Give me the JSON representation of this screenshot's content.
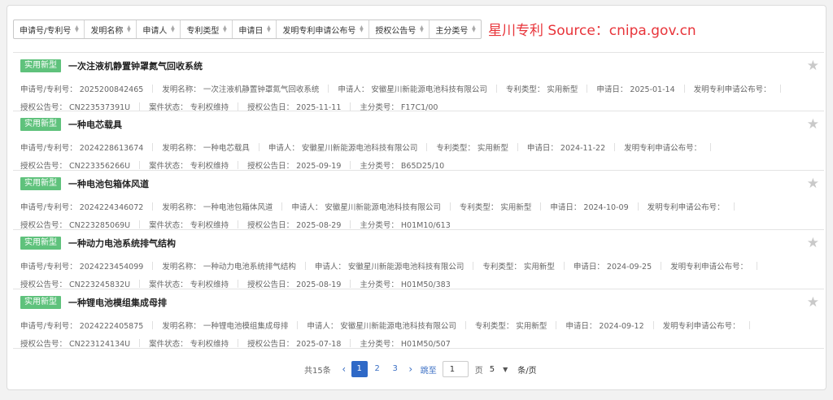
{
  "sort_fields": [
    {
      "label": "申请号/专利号"
    },
    {
      "label": "发明名称"
    },
    {
      "label": "申请人"
    },
    {
      "label": "专利类型"
    },
    {
      "label": "申请日"
    },
    {
      "label": "发明专利申请公布号"
    },
    {
      "label": "授权公告号"
    },
    {
      "label": "主分类号"
    }
  ],
  "watermark": "星川专利  Source：cnipa.gov.cn",
  "items": [
    {
      "tag": "实用新型",
      "title": "一次注液机静置钟罩氮气回收系统",
      "app_no": "申请号/专利号：  2025200842465",
      "name": "发明名称：  一次注液机静置钟罩氮气回收系统",
      "applicant": "申请人：  安徽星川新能源电池科技有限公司",
      "type": "专利类型：  实用新型",
      "date": "申请日：  2025-01-14",
      "pub_no": "发明专利申请公布号：",
      "grant_no": "授权公告号：  CN223537391U",
      "status": "案件状态：  专利权维持",
      "grant_date": "授权公告日：  2025-11-11",
      "main_class": "主分类号：  F17C1/00"
    },
    {
      "tag": "实用新型",
      "title": "一种电芯载具",
      "app_no": "申请号/专利号：  2024228613674",
      "name": "发明名称：  一种电芯载具",
      "applicant": "申请人：  安徽星川新能源电池科技有限公司",
      "type": "专利类型：  实用新型",
      "date": "申请日：  2024-11-22",
      "pub_no": "发明专利申请公布号：",
      "grant_no": "授权公告号：  CN223356266U",
      "status": "案件状态：  专利权维持",
      "grant_date": "授权公告日：  2025-09-19",
      "main_class": "主分类号：  B65D25/10"
    },
    {
      "tag": "实用新型",
      "title": "一种电池包箱体风道",
      "app_no": "申请号/专利号：  2024224346072",
      "name": "发明名称：  一种电池包箱体风道",
      "applicant": "申请人：  安徽星川新能源电池科技有限公司",
      "type": "专利类型：  实用新型",
      "date": "申请日：  2024-10-09",
      "pub_no": "发明专利申请公布号：",
      "grant_no": "授权公告号：  CN223285069U",
      "status": "案件状态：  专利权维持",
      "grant_date": "授权公告日：  2025-08-29",
      "main_class": "主分类号：  H01M10/613"
    },
    {
      "tag": "实用新型",
      "title": "一种动力电池系统排气结构",
      "app_no": "申请号/专利号：  2024223454099",
      "name": "发明名称：  一种动力电池系统排气结构",
      "applicant": "申请人：  安徽星川新能源电池科技有限公司",
      "type": "专利类型：  实用新型",
      "date": "申请日：  2024-09-25",
      "pub_no": "发明专利申请公布号：",
      "grant_no": "授权公告号：  CN223245832U",
      "status": "案件状态：  专利权维持",
      "grant_date": "授权公告日：  2025-08-19",
      "main_class": "主分类号：  H01M50/383"
    },
    {
      "tag": "实用新型",
      "title": "一种锂电池模组集成母排",
      "app_no": "申请号/专利号：  2024222405875",
      "name": "发明名称：  一种锂电池模组集成母排",
      "applicant": "申请人：  安徽星川新能源电池科技有限公司",
      "type": "专利类型：  实用新型",
      "date": "申请日：  2024-09-12",
      "pub_no": "发明专利申请公布号：",
      "grant_no": "授权公告号：  CN223124134U",
      "status": "案件状态：  专利权维持",
      "grant_date": "授权公告日：  2025-07-18",
      "main_class": "主分类号：  H01M50/507"
    }
  ],
  "pagination": {
    "total": "共15条",
    "pages": [
      "1",
      "2",
      "3"
    ],
    "current": "1",
    "jump_label": "跳至",
    "page_input": "1",
    "page_unit": "页",
    "page_size": "5",
    "per_page_unit": "条/页"
  }
}
